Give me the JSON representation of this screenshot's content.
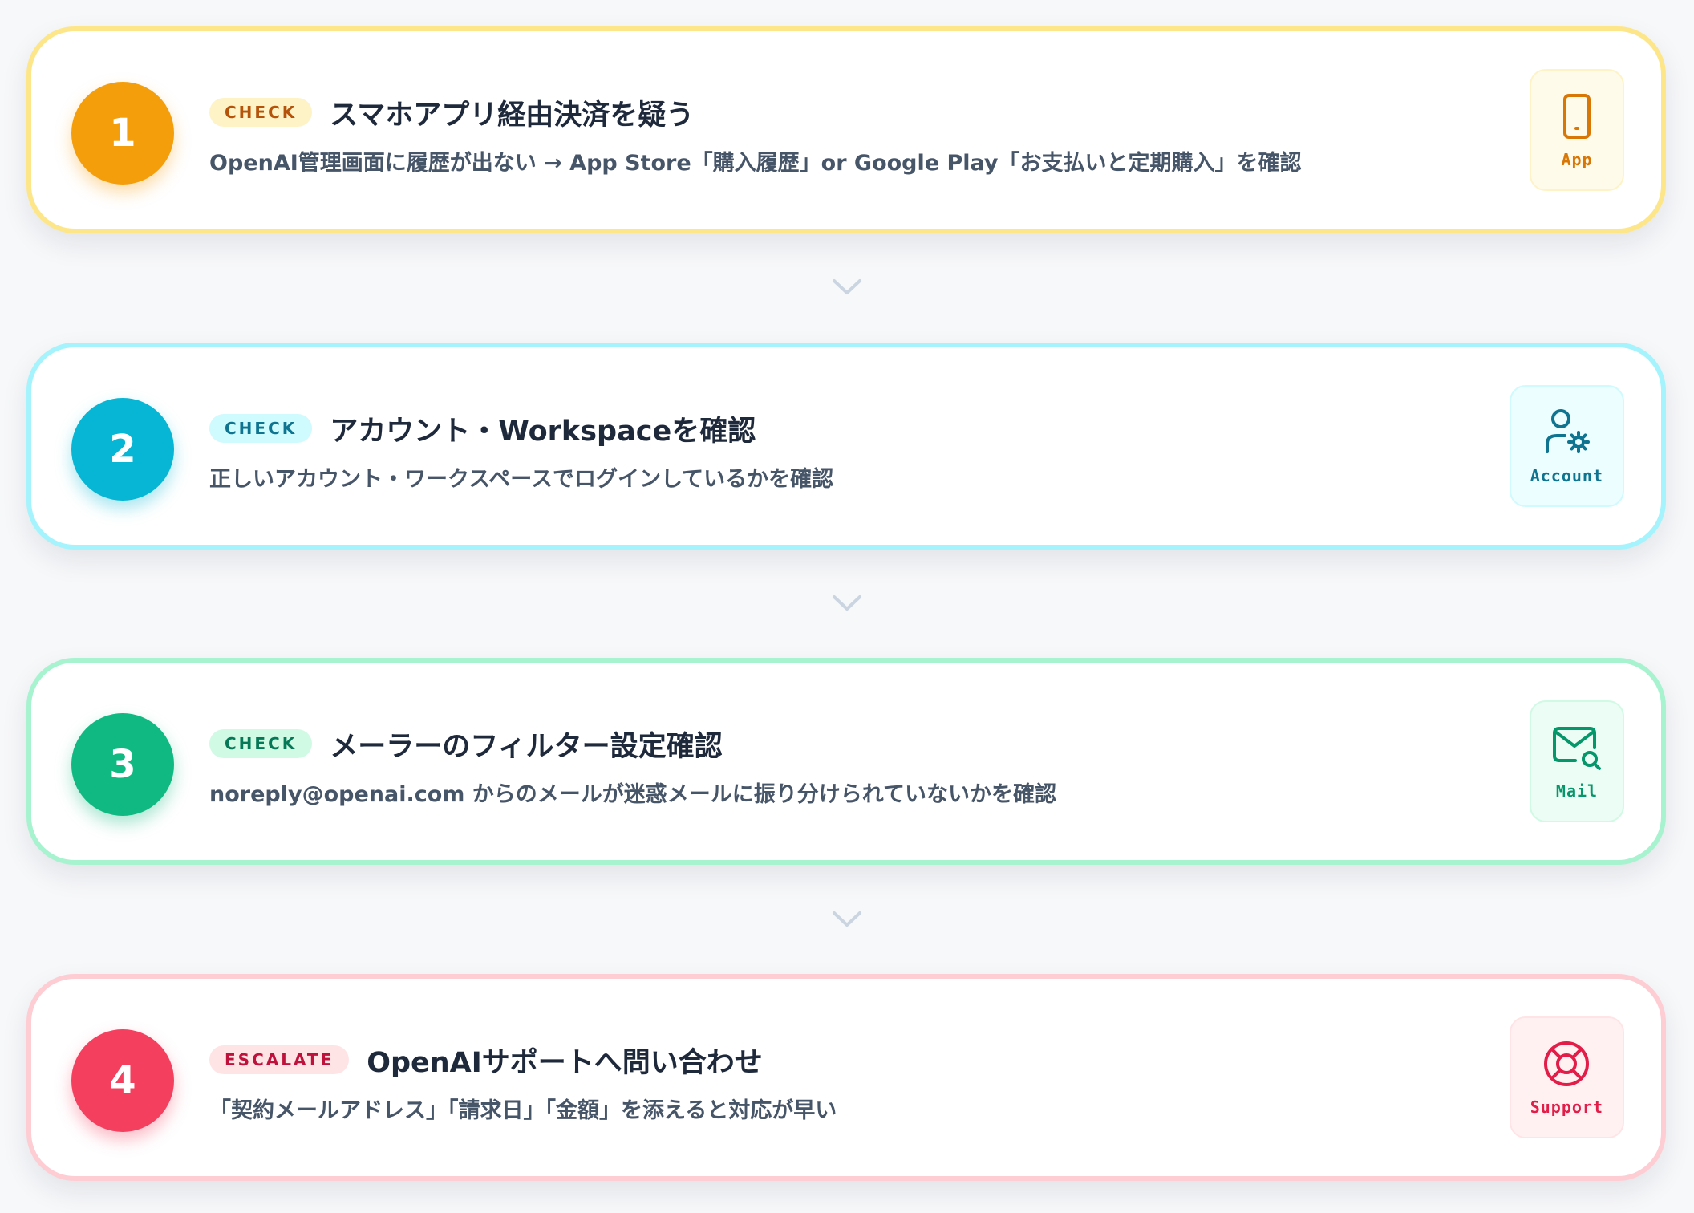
{
  "steps": [
    {
      "number": "1",
      "badge": "CHECK",
      "title": "スマホアプリ経由決済を疑う",
      "description": "OpenAI管理画面に履歴が出ない → App Store「購入履歴」or Google Play「お支払いと定期購入」を確認",
      "icon": "smartphone-icon",
      "icon_label": "App",
      "accent": "#f59e0b"
    },
    {
      "number": "2",
      "badge": "CHECK",
      "title": "アカウント・Workspaceを確認",
      "description": "正しいアカウント・ワークスペースでログインしているかを確認",
      "icon": "user-gear-icon",
      "icon_label": "Account",
      "accent": "#06b6d4"
    },
    {
      "number": "3",
      "badge": "CHECK",
      "title": "メーラーのフィルター設定確認",
      "description": "noreply@openai.com からのメールが迷惑メールに振り分けられていないかを確認",
      "icon": "mail-search-icon",
      "icon_label": "Mail",
      "accent": "#10b981"
    },
    {
      "number": "4",
      "badge": "ESCALATE",
      "title": "OpenAIサポートへ問い合わせ",
      "description": "「契約メールアドレス」「請求日」「金額」を添えると対応が早い",
      "icon": "lifebuoy-icon",
      "icon_label": "Support",
      "accent": "#f43f5e"
    }
  ],
  "connector_icon": "chevron-down-icon"
}
